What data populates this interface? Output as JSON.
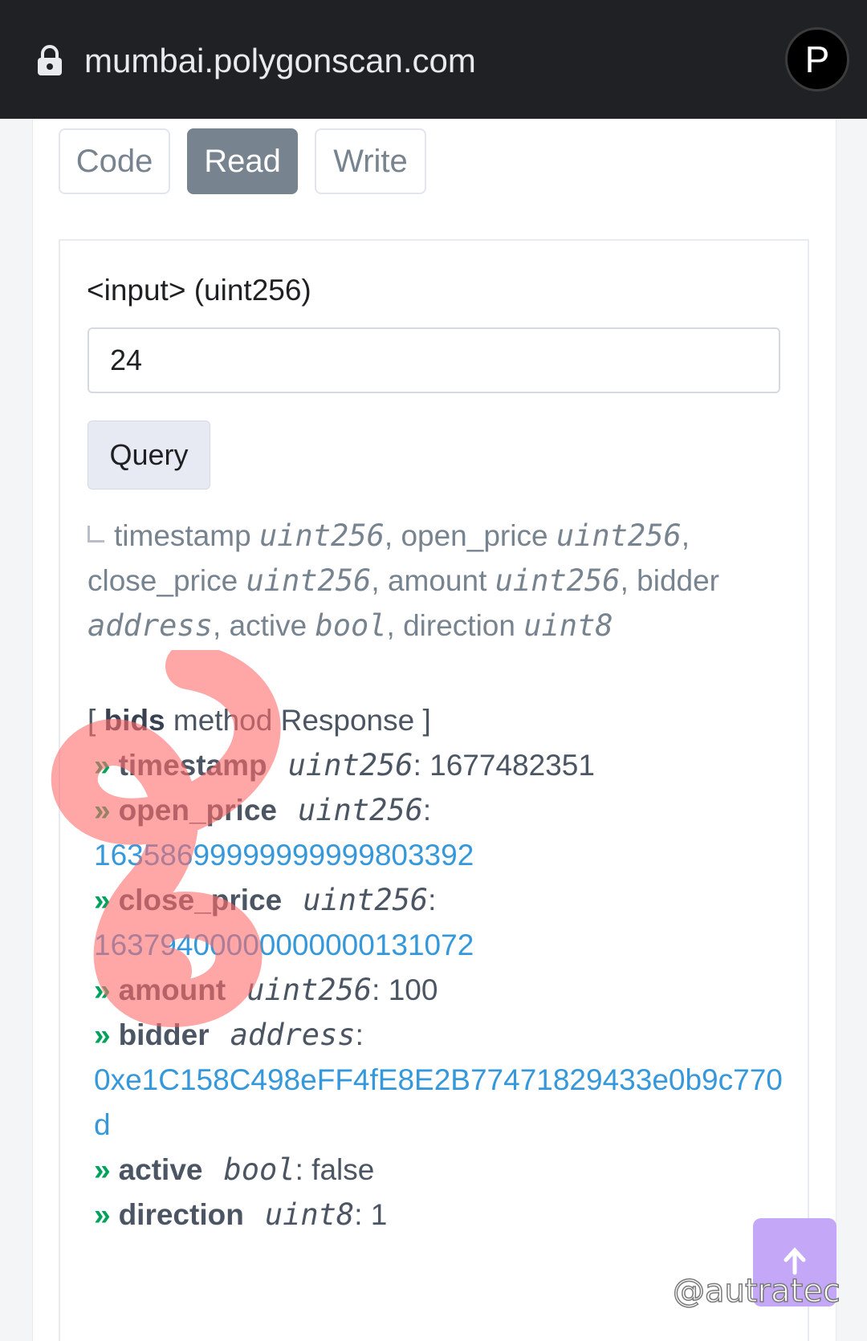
{
  "browser": {
    "url": "mumbai.polygonscan.com",
    "profile_initial": "P",
    "lock_icon": "lock-icon"
  },
  "tabs": [
    {
      "label": "Code",
      "active": false
    },
    {
      "label": "Read",
      "active": true
    },
    {
      "label": "Write",
      "active": false
    }
  ],
  "query_form": {
    "input_label": "<input> (uint256)",
    "input_value": "24",
    "query_button": "Query"
  },
  "signature": {
    "parts": [
      {
        "name": "timestamp",
        "type": "uint256"
      },
      {
        "name": "open_price",
        "type": "uint256"
      },
      {
        "name": "close_price",
        "type": "uint256"
      },
      {
        "name": "amount",
        "type": "uint256"
      },
      {
        "name": "bidder",
        "type": "address"
      },
      {
        "name": "active",
        "type": "bool"
      },
      {
        "name": "direction",
        "type": "uint8"
      }
    ]
  },
  "response": {
    "header_open": "[ ",
    "method": "bids",
    "header_rest": " method Response ]",
    "fields": [
      {
        "name": "timestamp",
        "type": "uint256",
        "value": "1677482351",
        "is_link": false
      },
      {
        "name": "open_price",
        "type": "uint256",
        "value": "16358699999999999803392",
        "is_link": true
      },
      {
        "name": "close_price",
        "type": "uint256",
        "value": "16379400000000000131072",
        "is_link": true
      },
      {
        "name": "amount",
        "type": "uint256",
        "value": "100",
        "is_link": false
      },
      {
        "name": "bidder",
        "type": "address",
        "value": "0xe1C158C498eFF4fE8E2B77471829433e0b9c770d",
        "is_link": true
      },
      {
        "name": "active",
        "type": "bool",
        "value": "false",
        "is_link": false
      },
      {
        "name": "direction",
        "type": "uint8",
        "value": "1",
        "is_link": false
      }
    ]
  },
  "scroll_top_icon": "arrow-up-icon",
  "watermark": "@autratec",
  "colors": {
    "active_tab": "#77838f",
    "link": "#3498db",
    "arrow": "#00a35c",
    "scroll_button": "#c4a7f6"
  }
}
